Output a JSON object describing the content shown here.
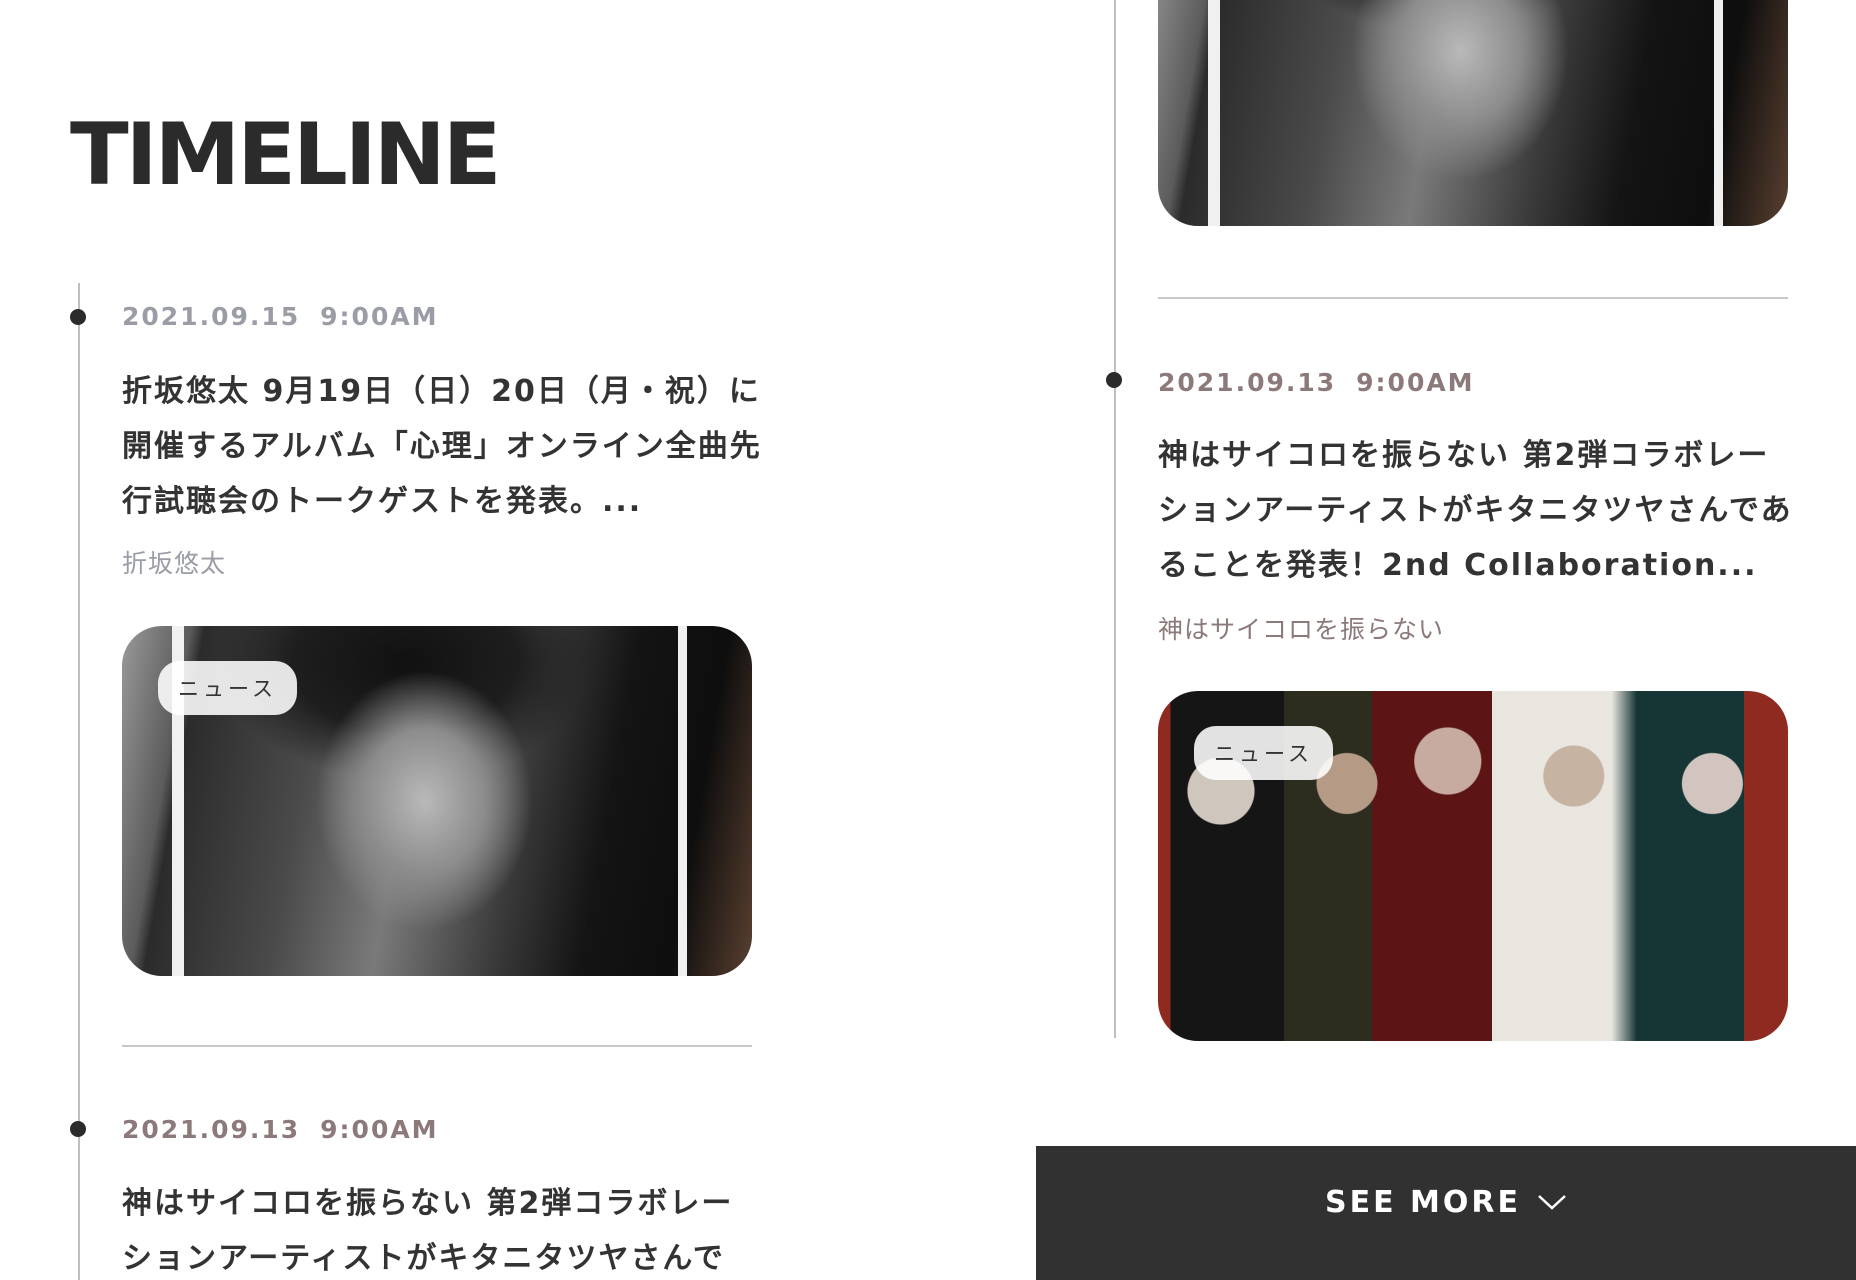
{
  "page": {
    "title": "TIMELINE"
  },
  "left_column": {
    "items": [
      {
        "date": "2021.09.15",
        "time": "9:00AM",
        "date_color": "#9a9ca6",
        "headline": "折坂悠太 9月19日（日）20日（月・祝）に開催するアルバム「心理」オンライン全曲先行試聴会のトークゲストを発表。...",
        "artist": "折坂悠太",
        "artist_color": "#9a9ca6",
        "tag": "ニュース"
      },
      {
        "date": "2021.09.13",
        "time": "9:00AM",
        "date_color": "#8c7a7a",
        "headline": "神はサイコロを振らない 第2弾コラボレーションアーティストがキタニタツヤさんで"
      }
    ]
  },
  "right_column": {
    "items": [
      {
        "date": "2021.09.13",
        "time": "9:00AM",
        "date_color": "#8c7a7a",
        "headline": "神はサイコロを振らない 第2弾コラボレーションアーティストがキタニタツヤさんであることを発表！2nd Collaboration...",
        "artist": "神はサイコロを振らない",
        "artist_color": "#8c7a7a",
        "tag": "ニュース"
      }
    ]
  },
  "see_more": {
    "label": "SEE MORE",
    "icon": "chevron-down-icon"
  }
}
